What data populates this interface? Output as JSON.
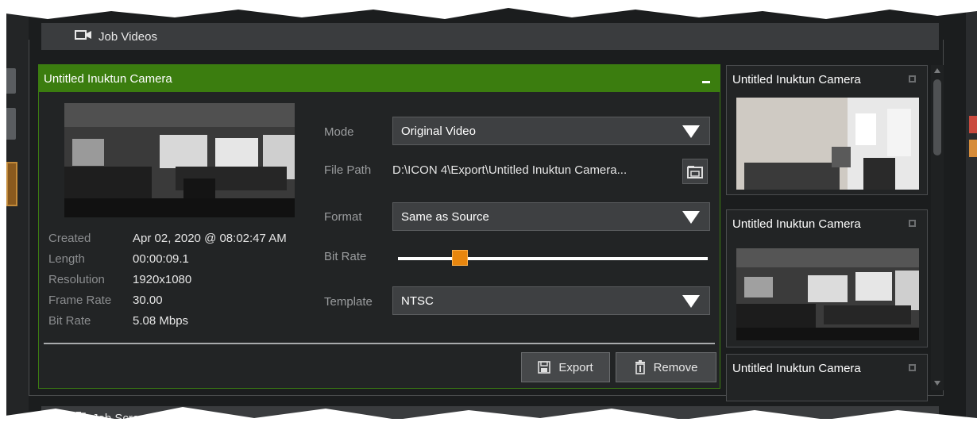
{
  "section": {
    "title": "Job Videos",
    "next_title": "Job Screenshots"
  },
  "card": {
    "title": "Untitled Inuktun Camera",
    "meta": [
      {
        "key": "Created",
        "value": "Apr 02, 2020 @ 08:02:47 AM"
      },
      {
        "key": "Length",
        "value": "00:00:09.1"
      },
      {
        "key": "Resolution",
        "value": "1920x1080"
      },
      {
        "key": "Frame Rate",
        "value": "30.00"
      },
      {
        "key": "Bit Rate",
        "value": "5.08 Mbps"
      }
    ],
    "form": {
      "mode_label": "Mode",
      "mode_value": "Original Video",
      "path_label": "File Path",
      "path_value": "D:\\ICON 4\\Export\\Untitled Inuktun Camera...",
      "format_label": "Format",
      "format_value": "Same as Source",
      "bitrate_label": "Bit Rate",
      "bitrate_level": 0.2,
      "template_label": "Template",
      "template_value": "NTSC"
    },
    "buttons": {
      "export": "Export",
      "remove": "Remove"
    }
  },
  "side_list": [
    {
      "title": "Untitled Inuktun Camera"
    },
    {
      "title": "Untitled Inuktun Camera"
    },
    {
      "title": "Untitled Inuktun Camera"
    }
  ],
  "colors": {
    "accent_green": "#3b7d0f",
    "slider_orange": "#e8860e"
  }
}
